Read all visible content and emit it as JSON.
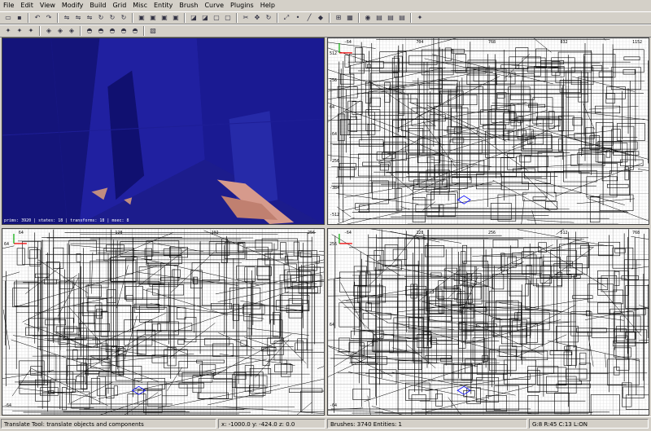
{
  "menu": [
    "File",
    "Edit",
    "View",
    "Modify",
    "Build",
    "Grid",
    "Misc",
    "Entity",
    "Brush",
    "Curve",
    "Plugins",
    "Help"
  ],
  "toolbar_icons_row1": [
    "open-icon",
    "save-icon",
    "undo-icon",
    "redo-icon",
    "flip-x-icon",
    "flip-y-icon",
    "flip-z-icon",
    "rotate-x-icon",
    "rotate-y-icon",
    "rotate-z-icon",
    "select-complete-tall-icon",
    "select-touching-icon",
    "select-partial-tall-icon",
    "select-inside-icon",
    "csg-subtract-icon",
    "csg-merge-icon",
    "make-hollow-icon",
    "make-room-icon",
    "clipper-icon",
    "translate-icon",
    "rotate-icon",
    "scale-icon",
    "vertex-edit-icon",
    "edge-edit-icon",
    "face-edit-icon",
    "texture-lock-icon",
    "patch-icon",
    "camera-icon",
    "view-xy-icon",
    "view-xz-icon",
    "view-yz-icon",
    "plugin-icon"
  ],
  "toolbar_icons_row2": [
    "plugin-a-icon",
    "plugin-b-icon",
    "plugin-c-icon",
    "bobtoolz-icon",
    "bobtoolz-b-icon",
    "bobtoolz-c-icon",
    "cat-a-icon",
    "cat-b-icon",
    "cat-c-icon",
    "cat-d-icon",
    "cat-e-icon",
    "gen-surf-icon"
  ],
  "camera": {
    "info": "prims: 3920 | states: 18 | transforms: 18 | msec: 8"
  },
  "views": {
    "xy": {
      "ticks_top": [
        "-64",
        "704",
        "768",
        "832",
        "1152"
      ],
      "ticks_left": [
        "512",
        "256",
        "64",
        "-64",
        "-256",
        "-384",
        "-512"
      ]
    },
    "xz": {
      "ticks_top": [
        "64",
        "128",
        "192",
        "256"
      ],
      "ticks_left": [
        "64",
        "-64"
      ]
    },
    "yz": {
      "ticks_top": [
        "-64",
        "128",
        "256",
        "512",
        "768"
      ],
      "ticks_left": [
        "256",
        "64",
        "-64"
      ]
    }
  },
  "status": {
    "help": "Translate Tool: translate objects and components",
    "coords": "x:  -1000.0  y:  -424.0  z:     0.0",
    "counts": "Brushes: 3740 Entities: 1",
    "grid": "G:8  R:45  C:13  L:ON"
  }
}
